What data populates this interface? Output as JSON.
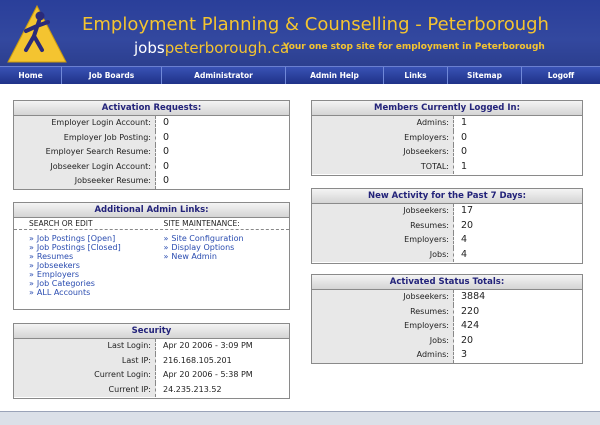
{
  "header": {
    "title": "Employment Planning & Counselling - Peterborough",
    "site_prefix": "jobs",
    "site_domain": "peterborough.ca",
    "tagline": "Your one stop site for employment in Peterborough"
  },
  "nav": {
    "items": [
      "Home",
      "Job Boards",
      "Administrator",
      "Admin Help",
      "Links",
      "Sitemap",
      "Logoff"
    ]
  },
  "activation": {
    "title": "Activation Requests:",
    "rows": [
      {
        "label": "Employer Login Account:",
        "value": "0"
      },
      {
        "label": "Employer Job Posting:",
        "value": "0"
      },
      {
        "label": "Employer Search Resume:",
        "value": "0"
      },
      {
        "label": "Jobseeker Login Account:",
        "value": "0"
      },
      {
        "label": "Jobseeker Resume:",
        "value": "0"
      }
    ]
  },
  "admin_links": {
    "title": "Additional Admin Links:",
    "col1_header": "SEARCH OR EDIT",
    "col2_header": "SITE MAINTENANCE:",
    "col1": [
      "Job Postings [Open]",
      "Job Postings [Closed]",
      "Resumes",
      "Jobseekers",
      "Employers",
      "Job Categories",
      "ALL Accounts"
    ],
    "col2": [
      "Site Configuration",
      "Display Options",
      "New Admin"
    ],
    "chevron": "»"
  },
  "security": {
    "title": "Security",
    "rows": [
      {
        "label": "Last Login:",
        "value": "Apr 20 2006 - 3:09 PM"
      },
      {
        "label": "Last IP:",
        "value": "216.168.105.201"
      },
      {
        "label": "Current Login:",
        "value": "Apr 20 2006 - 5:38 PM"
      },
      {
        "label": "Current IP:",
        "value": "24.235.213.52"
      }
    ]
  },
  "logged_in": {
    "title": "Members Currently Logged In:",
    "rows": [
      {
        "label": "Admins:",
        "value": "1"
      },
      {
        "label": "Employers:",
        "value": "0"
      },
      {
        "label": "Jobseekers:",
        "value": "0"
      },
      {
        "label": "TOTAL:",
        "value": "1"
      }
    ]
  },
  "new_activity": {
    "title": "New Activity for the Past 7 Days:",
    "rows": [
      {
        "label": "Jobseekers:",
        "value": "17"
      },
      {
        "label": "Resumes:",
        "value": "20"
      },
      {
        "label": "Employers:",
        "value": "4"
      },
      {
        "label": "Jobs:",
        "value": "4"
      }
    ]
  },
  "status_totals": {
    "title": "Activated Status Totals:",
    "rows": [
      {
        "label": "Jobseekers:",
        "value": "3884"
      },
      {
        "label": "Resumes:",
        "value": "220"
      },
      {
        "label": "Employers:",
        "value": "424"
      },
      {
        "label": "Jobs:",
        "value": "20"
      },
      {
        "label": "Admins:",
        "value": "3"
      }
    ]
  },
  "colors": {
    "banner_blue": "#2a3f9a",
    "title_gold": "#f4c430",
    "link_blue": "#2a4cb0",
    "panel_title_text": "#23237a"
  }
}
